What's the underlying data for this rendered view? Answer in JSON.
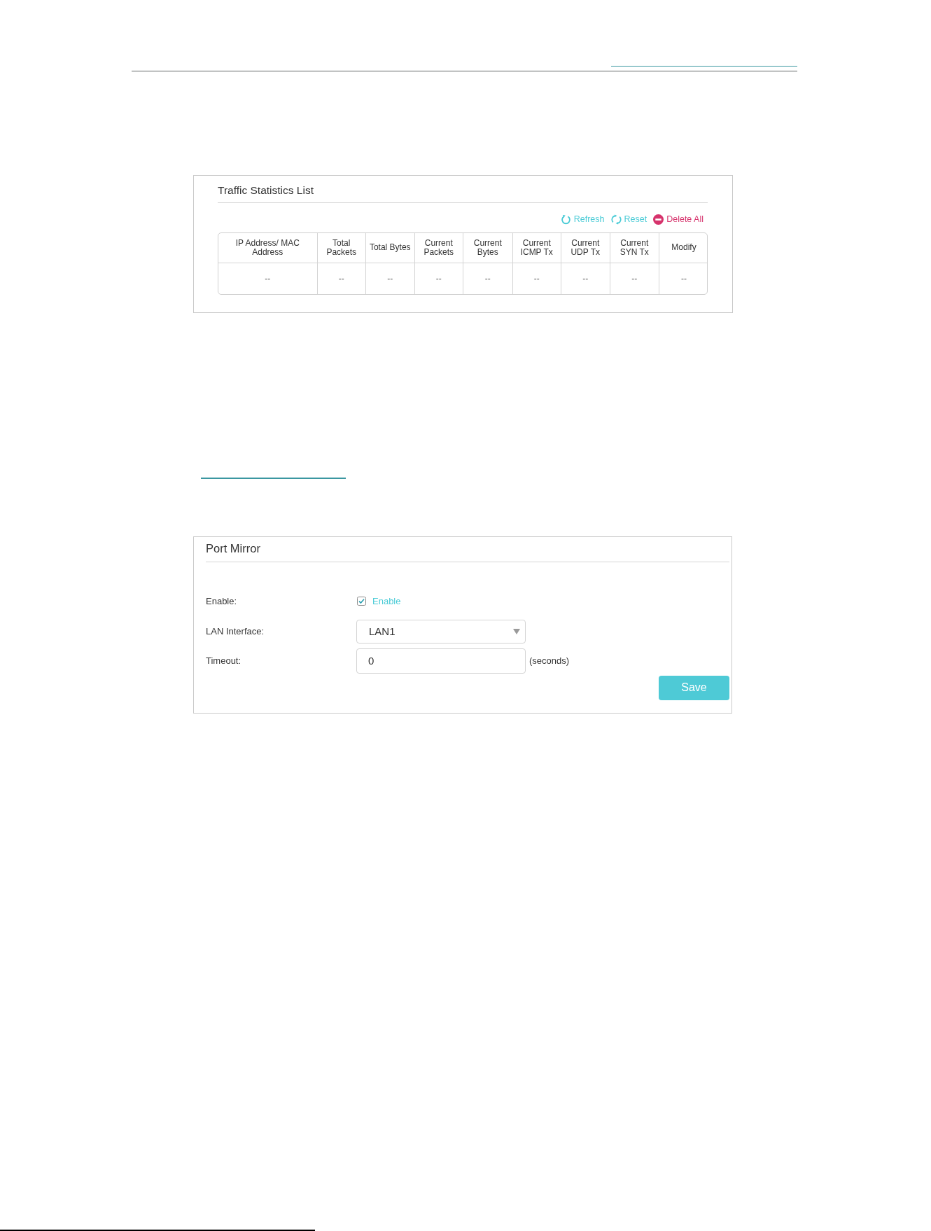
{
  "traffic_statistics": {
    "title": "Traffic Statistics List",
    "actions": [
      {
        "kind": "refresh",
        "label": "Refresh"
      },
      {
        "kind": "reset",
        "label": "Reset"
      },
      {
        "kind": "delete",
        "label": "Delete All"
      }
    ],
    "table": {
      "columns": [
        "IP Address/ MAC Address",
        "Total Packets",
        "Total Bytes",
        "Current Packets",
        "Current Bytes",
        "Current ICMP Tx",
        "Current UDP Tx",
        "Current SYN Tx",
        "Modify"
      ],
      "rows": [
        [
          "--",
          "--",
          "--",
          "--",
          "--",
          "--",
          "--",
          "--",
          "--"
        ]
      ]
    }
  },
  "port_mirror": {
    "title": "Port Mirror",
    "fields": [
      {
        "kind": "checkbox",
        "label": "Enable:",
        "option": "Enable",
        "checked": true
      },
      {
        "kind": "select",
        "label": "LAN Interface:",
        "value": "LAN1"
      },
      {
        "kind": "input",
        "label": "Timeout:",
        "value": "0",
        "unit": "(seconds)"
      }
    ],
    "buttons": [
      "Save"
    ]
  }
}
